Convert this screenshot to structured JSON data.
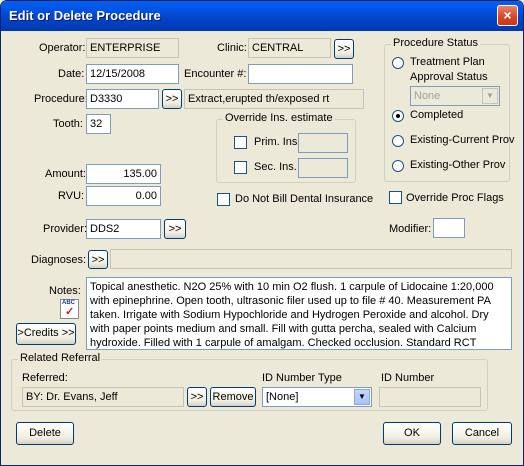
{
  "window": {
    "title": "Edit or Delete Procedure",
    "close_glyph": "×"
  },
  "operator": {
    "label": "Operator:",
    "value": "ENTERPRISE"
  },
  "clinic": {
    "label": "Clinic:",
    "value": "CENTRAL",
    "pick_label": ">>"
  },
  "date": {
    "label": "Date:",
    "value": "12/15/2008"
  },
  "encounter": {
    "label": "Encounter #:",
    "value": ""
  },
  "procedure": {
    "label": "Procedure:",
    "code": "D3330",
    "pick_label": ">>",
    "description": "Extract,erupted th/exposed rt"
  },
  "tooth": {
    "label": "Tooth:",
    "value": "32"
  },
  "override": {
    "legend": "Override Ins. estimate",
    "prim_label": "Prim. Ins",
    "sec_label": "Sec. Ins."
  },
  "status": {
    "legend": "Procedure Status",
    "treatment_plan": "Treatment Plan",
    "approval_label": "Approval Status",
    "approval_value": "None",
    "completed": "Completed",
    "existing_current": "Existing-Current Prov",
    "existing_other": "Existing-Other Prov",
    "selected": "completed"
  },
  "amount": {
    "label": "Amount:",
    "value": "135.00"
  },
  "rvu": {
    "label": "RVU:",
    "value": "0.00"
  },
  "do_not_bill": {
    "label": "Do Not Bill Dental Insurance"
  },
  "override_flags": {
    "label": "Override Proc Flags"
  },
  "provider": {
    "label": "Provider:",
    "value": "DDS2",
    "pick_label": ">>"
  },
  "modifier": {
    "label": "Modifier:",
    "value": ""
  },
  "diagnoses": {
    "label": "Diagnoses:",
    "pick_label": ">>",
    "value": ""
  },
  "notes": {
    "label": "Notes:",
    "spell_label": "ABC",
    "text": "Topical anesthetic.  N2O 25% with 10 min O2 flush.  1 carpule of Lidocaine 1:20,000 with epinephrine.  Open tooth, ultrasonic filer used up to file # 40.  Measurement PA taken.  Irrigate with Sodium Hypochloride and Hydrogen Peroxide and alcohol.  Dry with paper points medium and small.  Fill with gutta percha, sealed with Calcium hydroxide.  Filled with 1 carpule of amalgam.  Checked occlusion.  Standard RCT"
  },
  "credits_button": ">Credits >>",
  "referral": {
    "legend": "Related Referral",
    "referred_label": "Referred:",
    "referred_value": "BY: Dr. Evans, Jeff",
    "pick_label": ">>",
    "remove_label": "Remove",
    "id_type_label": "ID Number Type",
    "id_type_value": "[None]",
    "id_number_label": "ID Number",
    "id_number_value": ""
  },
  "buttons": {
    "delete": "Delete",
    "ok": "OK",
    "cancel": "Cancel"
  }
}
